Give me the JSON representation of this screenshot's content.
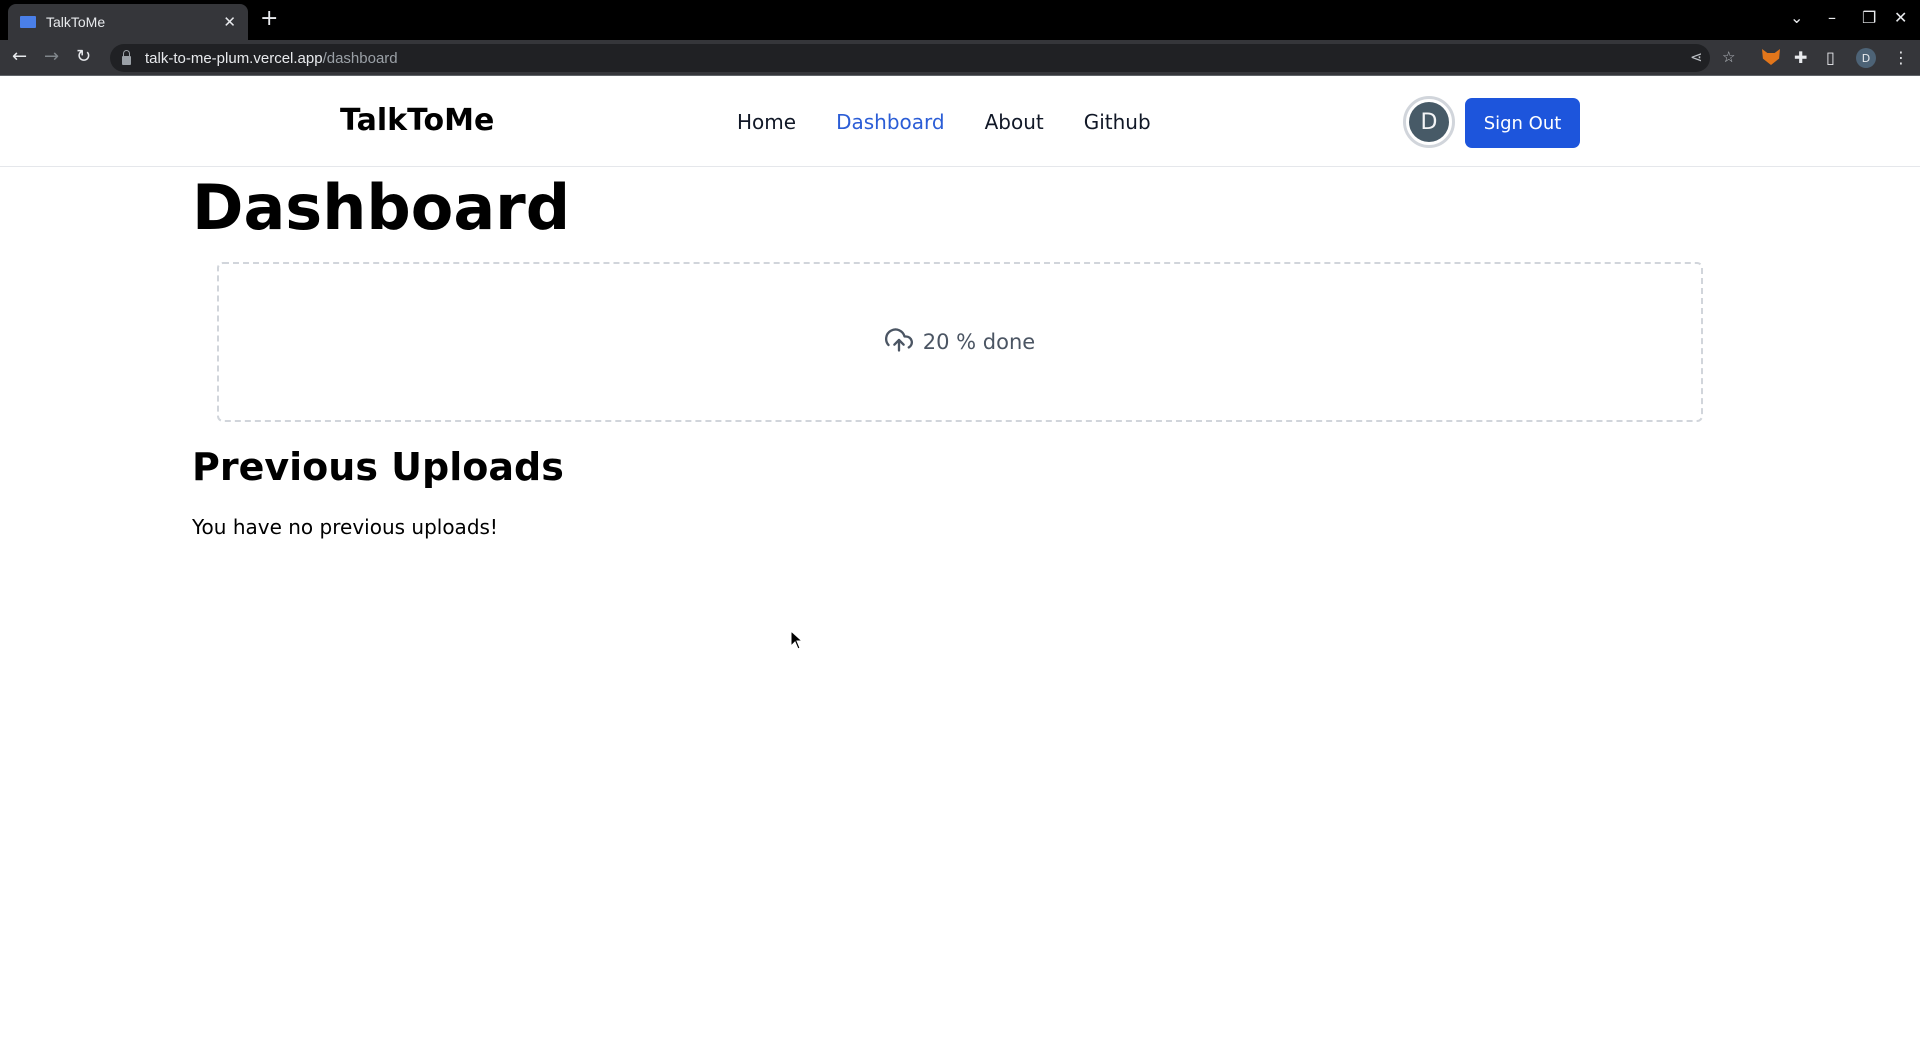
{
  "browser": {
    "tab_title": "TalkToMe",
    "url_host": "talk-to-me-plum.vercel.app",
    "url_path": "/dashboard",
    "profile_initial": "D"
  },
  "site": {
    "brand": "TalkToMe",
    "nav": [
      {
        "label": "Home",
        "active": false
      },
      {
        "label": "Dashboard",
        "active": true
      },
      {
        "label": "About",
        "active": false
      },
      {
        "label": "Github",
        "active": false
      }
    ],
    "avatar_initial": "D",
    "sign_out_label": "Sign Out",
    "accent_color": "#1d55dc"
  },
  "main": {
    "title": "Dashboard",
    "upload": {
      "icon": "cloud-upload-icon",
      "progress_percent": 20,
      "status_text": "20 % done"
    },
    "previous_uploads": {
      "title": "Previous Uploads",
      "empty_message": "You have no previous uploads!"
    }
  }
}
